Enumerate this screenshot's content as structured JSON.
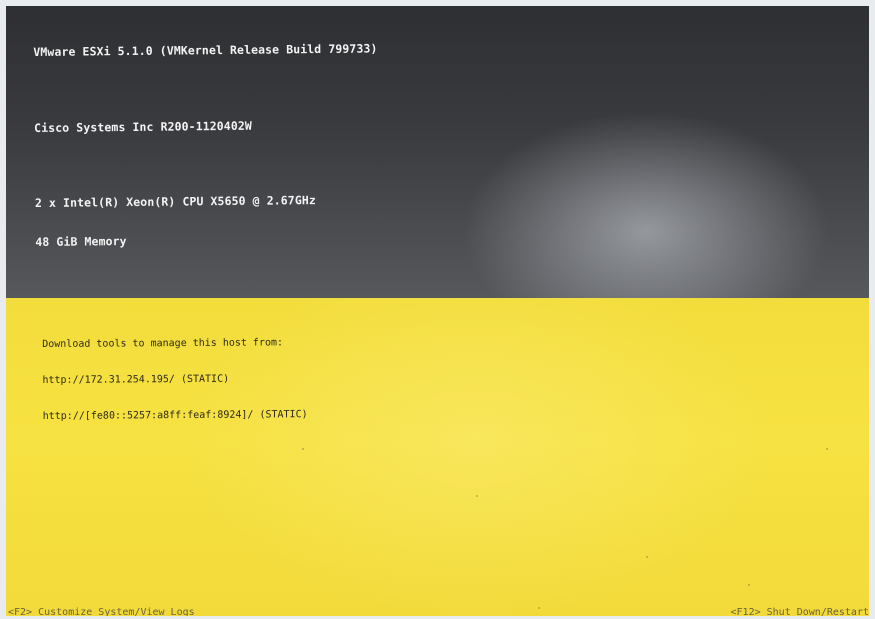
{
  "system": {
    "lines": [
      "VMware ESXi 5.1.0 (VMKernel Release Build 799733)",
      "Cisco Systems Inc R200-1120402W",
      "2 x Intel(R) Xeon(R) CPU X5650 @ 2.67GHz",
      "48 GiB Memory"
    ]
  },
  "download": {
    "heading": "Download tools to manage this host from:",
    "urls": [
      "http://172.31.254.195/ (STATIC)",
      "http://[fe80::5257:a8ff:feaf:8924]/ (STATIC)"
    ]
  },
  "footer": {
    "left": "<F2> Customize System/View Logs",
    "right": "<F12> Shut Down/Restart"
  },
  "colors": {
    "top_bg": "#3b3c40",
    "bottom_bg": "#f3dd3c",
    "top_text": "#f4f4f4",
    "bottom_text": "#2d2a1a"
  }
}
